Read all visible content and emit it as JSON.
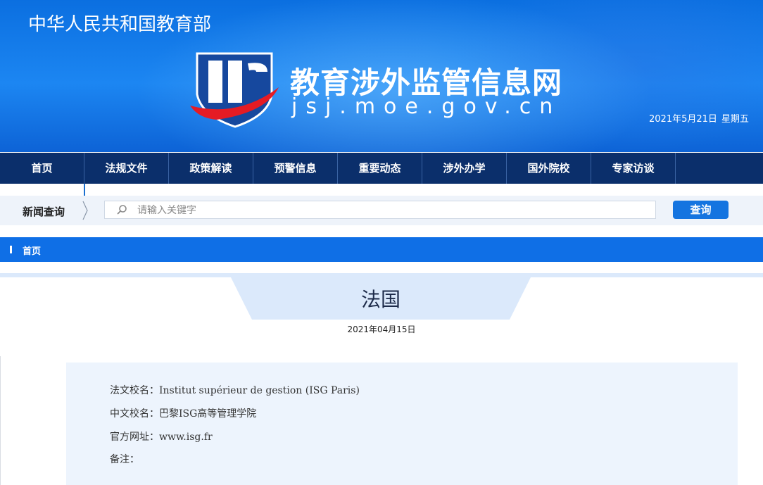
{
  "header": {
    "ministry": "中华人民共和国教育部",
    "site_title": "教育涉外监管信息网",
    "site_domain": "jsj.moe.gov.cn",
    "date": "2021年5月21日",
    "weekday": "星期五"
  },
  "nav": {
    "items": [
      "首页",
      "法规文件",
      "政策解读",
      "预警信息",
      "重要动态",
      "涉外办学",
      "国外院校",
      "专家访谈"
    ]
  },
  "search": {
    "label": "新闻查询",
    "placeholder": "请输入关键字",
    "button": "查询"
  },
  "breadcrumb": {
    "home": "首页"
  },
  "article": {
    "title": "法国",
    "date": "2021年04月15日",
    "lines": [
      "法文校名：Institut supérieur de gestion (ISG Paris)",
      "中文校名：巴黎ISG高等管理学院",
      "官方网址：www.isg.fr",
      "备注："
    ]
  },
  "colors": {
    "banner_blue": "#0b6fe0",
    "nav_navy": "#0b2f6b",
    "accent_blue": "#0f6fe6",
    "logo_red": "#e51b24",
    "content_bg": "#edf4fd"
  }
}
